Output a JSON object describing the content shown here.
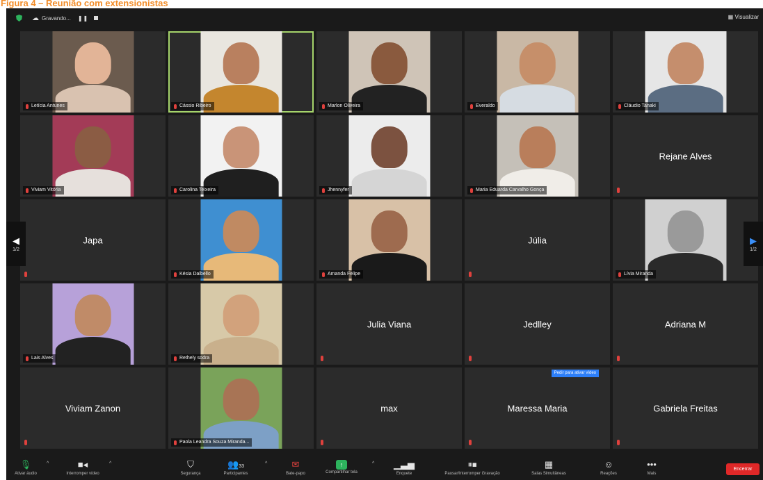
{
  "caption": "Figura 4 – Reunião com extensionistas",
  "topbar": {
    "recording_name": "Gravando...",
    "view_label": "Visualizar"
  },
  "colors": {
    "caption": "#f28c28",
    "active_speaker": "#a6d56b",
    "muted": "#e0413d",
    "accent": "#2d7ff9",
    "end": "#e02828"
  },
  "tiles": [
    {
      "name": "Letícia Antunes",
      "type": "video",
      "bg": "#6b5b4e",
      "skin": "#e2b497",
      "shirt": "#d9c2b0"
    },
    {
      "name": "Cássio Ribeiro",
      "type": "video",
      "bg": "#e9e6df",
      "skin": "#b9805f",
      "shirt": "#c4862e",
      "active": true
    },
    {
      "name": "Marlon Oliveira",
      "type": "video",
      "bg": "#cfc4b7",
      "skin": "#8a5a3e",
      "shirt": "#222222"
    },
    {
      "name": "Everaldo",
      "type": "video",
      "bg": "#c9b8a5",
      "skin": "#c68f6a",
      "shirt": "#d6dce2"
    },
    {
      "name": "Cláudio Tanaki",
      "type": "video",
      "bg": "#e6e6e6",
      "skin": "#c58e6d",
      "shirt": "#5b6d82"
    },
    {
      "name": "Viviam Vitória",
      "type": "video",
      "bg": "#a33b57",
      "skin": "#8b5c44",
      "shirt": "#e6e0dc"
    },
    {
      "name": "Carolina Teixeira",
      "type": "video",
      "bg": "#f2f2f2",
      "skin": "#c99478",
      "shirt": "#1f1f1f"
    },
    {
      "name": "Jhennyfer",
      "type": "video",
      "bg": "#ececec",
      "skin": "#7c5240",
      "shirt": "#d5d5d5"
    },
    {
      "name": "Maria Eduarda Carvalho Gonça",
      "type": "video",
      "bg": "#c5c0b8",
      "skin": "#b97e5b",
      "shirt": "#f0ede8"
    },
    {
      "name": "Rejane Alves",
      "type": "name"
    },
    {
      "name": "Japa",
      "type": "name"
    },
    {
      "name": "Késia Dalbello",
      "type": "video",
      "bg": "#3f8fd1",
      "skin": "#c08a62",
      "shirt": "#e7b979"
    },
    {
      "name": "Amanda Felipe",
      "type": "video",
      "bg": "#d8c1a7",
      "skin": "#9e6b4f",
      "shirt": "#1a1a1a"
    },
    {
      "name": "Júlia",
      "type": "name"
    },
    {
      "name": "Lívia Miranda",
      "type": "video",
      "bg": "#d0d0d0",
      "skin": "#9a9a9a",
      "shirt": "#2a2a2a"
    },
    {
      "name": "Lais Alves",
      "type": "video",
      "bg": "#b7a1d9",
      "skin": "#c08b68",
      "shirt": "#222222"
    },
    {
      "name": "Rethely sodra",
      "type": "video",
      "bg": "#d7c9a8",
      "skin": "#d2a27c",
      "shirt": "#c9b08c"
    },
    {
      "name": "",
      "type": "name",
      "center": "Julia Viana"
    },
    {
      "name": "",
      "type": "name",
      "center": "Jedlley"
    },
    {
      "name": "",
      "type": "name",
      "center": "Adriana M"
    },
    {
      "name": "",
      "type": "name",
      "center": "Viviam Zanon"
    },
    {
      "name": "Paola Leandra Souza Miranda...",
      "type": "video",
      "bg": "#7aa35a",
      "skin": "#a87455",
      "shirt": "#7da0c6"
    },
    {
      "name": "",
      "type": "name",
      "center": "max"
    },
    {
      "name": "",
      "type": "name",
      "center": "Maressa Maria",
      "banner": "Pedir para ativar vídeo"
    },
    {
      "name": "",
      "type": "name",
      "center": "Gabriela Freitas"
    }
  ],
  "pagination": {
    "left": "1/2",
    "right": "1/2"
  },
  "toolbar": {
    "mute": "Ativar áudio",
    "video": "Interromper vídeo",
    "security": "Segurança",
    "participants": "Participantes",
    "participants_count": "33",
    "chat": "Bate-papo",
    "share": "Compartilhar tela",
    "polls": "Enquete",
    "record": "Pausar/Interromper Gravação",
    "breakout": "Salas Simultâneas",
    "reactions": "Reações",
    "more": "Mais",
    "end": "Encerrar"
  }
}
